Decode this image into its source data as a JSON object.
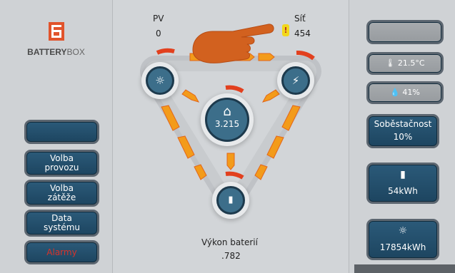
{
  "brand": {
    "bold": "BATTERY",
    "thin": "BOX"
  },
  "sidebar": {
    "items": [
      {
        "label": ""
      },
      {
        "label": "Volba\nprovozu"
      },
      {
        "label": "Volba\nzátěže"
      },
      {
        "label": "Data\nsystému"
      },
      {
        "label": "Alarmy"
      }
    ]
  },
  "pv": {
    "label": "PV",
    "value": "0"
  },
  "grid": {
    "label": "Síť",
    "value": "454",
    "warning": "!"
  },
  "home": {
    "value": "3.215"
  },
  "battery": {
    "label": "Výkon baterií",
    "value": ".782"
  },
  "status": {
    "temperature": "21.5°C",
    "humidity": "41%",
    "self_sufficiency_label": "Soběstačnost",
    "self_sufficiency_value": "10%",
    "battery_capacity": "54kWh",
    "solar_total": "17854kWh"
  },
  "colors": {
    "accent": "#e1542c",
    "panel": "#2b5a79",
    "flow_arrow": "#f39b1a",
    "alarm": "#d8322a"
  }
}
